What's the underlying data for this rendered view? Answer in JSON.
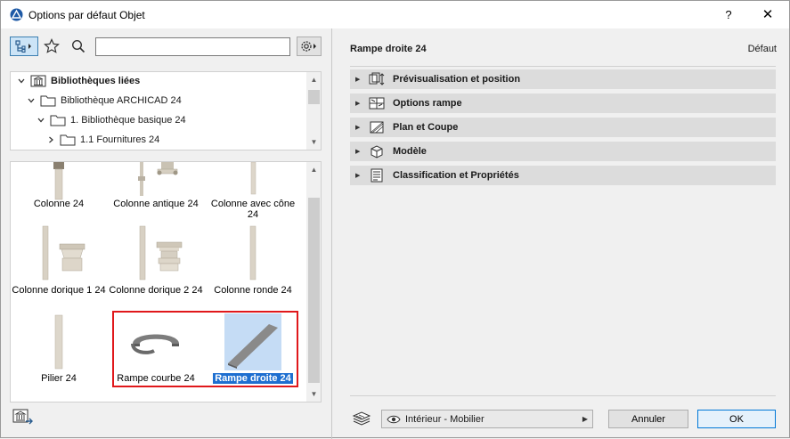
{
  "window": {
    "title": "Options par défaut Objet",
    "help_label": "?",
    "close_label": "✕"
  },
  "toolbar": {
    "search_value": ""
  },
  "tree": {
    "items": [
      {
        "label": "Bibliothèques liées",
        "bold": true
      },
      {
        "label": "Bibliothèque ARCHICAD 24"
      },
      {
        "label": "1. Bibliothèque basique 24"
      },
      {
        "label": "1.1 Fournitures 24"
      }
    ]
  },
  "objects": {
    "items": [
      {
        "label": "Colonne 24"
      },
      {
        "label": "Colonne antique 24"
      },
      {
        "label": "Colonne avec cône 24"
      },
      {
        "label": "Colonne dorique 1 24"
      },
      {
        "label": "Colonne dorique 2 24"
      },
      {
        "label": "Colonne ronde 24"
      },
      {
        "label": "Pilier 24"
      },
      {
        "label": "Rampe courbe 24"
      },
      {
        "label": "Rampe droite 24",
        "selected": true
      }
    ]
  },
  "settings": {
    "title": "Rampe droite 24",
    "default_label": "Défaut",
    "sections": [
      {
        "label": "Prévisualisation et position",
        "icon": "preview-position-icon"
      },
      {
        "label": "Options rampe",
        "icon": "ramp-options-icon"
      },
      {
        "label": "Plan et Coupe",
        "icon": "plan-section-icon"
      },
      {
        "label": "Modèle",
        "icon": "model-cube-icon"
      },
      {
        "label": "Classification et Propriétés",
        "icon": "classification-icon"
      }
    ]
  },
  "footer": {
    "layer_value": "Intérieur - Mobilier",
    "cancel_label": "Annuler",
    "ok_label": "OK"
  },
  "colors": {
    "selection": "#1e6fd0",
    "highlight_border": "#e0181b",
    "section_bg": "#dcdcdc"
  }
}
